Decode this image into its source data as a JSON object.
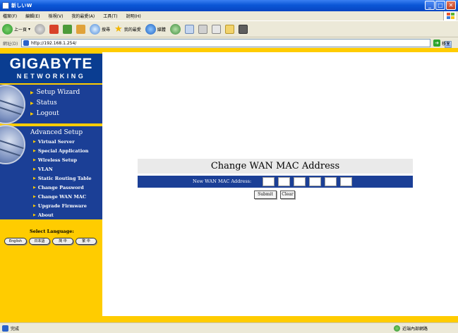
{
  "window": {
    "title": "新しいW",
    "buttons": {
      "minimize": "_",
      "maximize": "□",
      "close": "✕"
    }
  },
  "menu": [
    "檔案(F)",
    "編輯(E)",
    "檢視(V)",
    "我的最愛(A)",
    "工具(T)",
    "說明(H)"
  ],
  "toolbar": {
    "back": "上一頁",
    "search": "搜尋",
    "favorites": "我的最愛",
    "media": "媒體"
  },
  "address": {
    "label": "網址(D)",
    "url": "http://192.168.1.254/",
    "go": "移至"
  },
  "brand": {
    "name": "GIGABYTE",
    "tagline": "NETWORKING"
  },
  "nav_main": [
    "Setup Wizard",
    "Status",
    "Logout"
  ],
  "nav_advanced": {
    "title": "Advanced Setup",
    "items": [
      "Virtual Server",
      "Special Application",
      "Wireless Setup",
      "VLAN",
      "Static Routing Table",
      "Change Password",
      "Change WAN MAC",
      "Upgrade Firmware",
      "About"
    ]
  },
  "language": {
    "title": "Select Language:",
    "options": [
      "English",
      "日本語",
      "简 中",
      "繁 中"
    ]
  },
  "form": {
    "title": "Change WAN MAC Address",
    "label": "New WAN MAC Address:",
    "mac_fields": [
      "",
      "",
      "",
      "",
      "",
      ""
    ],
    "submit": "Submit",
    "clear": "Clear"
  },
  "status": {
    "left": "完成",
    "zone": "近端內部網路"
  }
}
